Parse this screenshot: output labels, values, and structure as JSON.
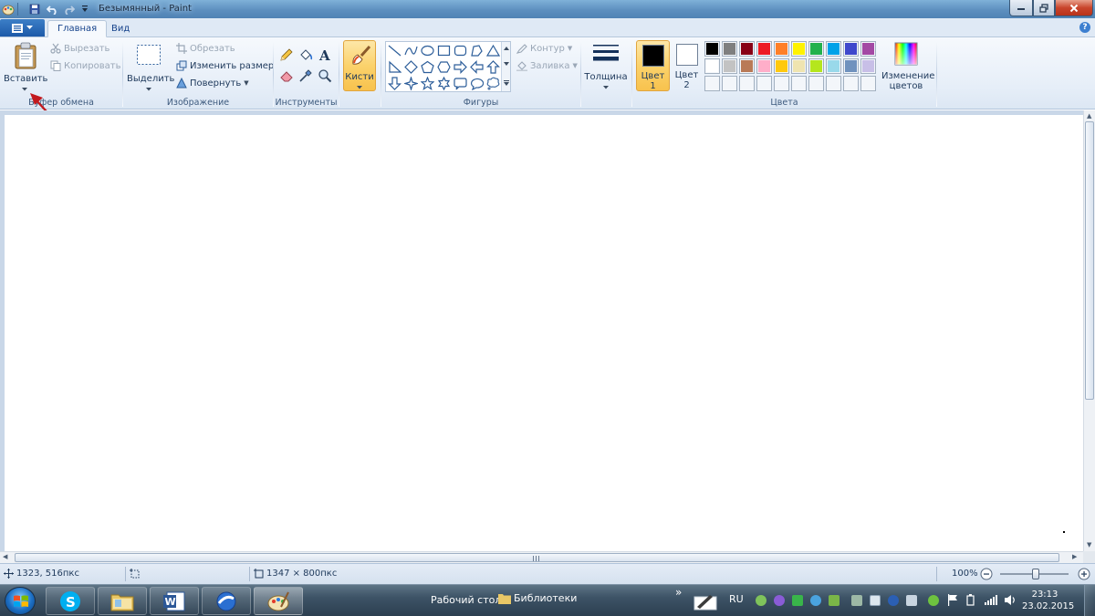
{
  "window": {
    "title": "Безымянный - Paint"
  },
  "tabs": {
    "home": "Главная",
    "view": "Вид"
  },
  "clipboard": {
    "paste_label": "Вставить",
    "cut_label": "Вырезать",
    "copy_label": "Копировать",
    "group_label": "Буфер обмена"
  },
  "image": {
    "select_label": "Выделить",
    "crop_label": "Обрезать",
    "resize_label": "Изменить размер",
    "rotate_label": "Повернуть",
    "group_label": "Изображение"
  },
  "tools": {
    "group_label": "Инструменты",
    "items": [
      "pencil-icon",
      "fill-icon",
      "text-icon",
      "eraser-icon",
      "color-picker-icon",
      "magnifier-icon"
    ]
  },
  "brushes": {
    "label": "Кисти"
  },
  "shapes": {
    "group_label": "Фигуры",
    "outline_label": "Контур",
    "fill_label": "Заливка",
    "items": [
      "line",
      "curve",
      "oval",
      "rectangle",
      "rounded-rectangle",
      "polygon",
      "triangle",
      "right-triangle",
      "diamond",
      "pentagon",
      "hexagon",
      "right-arrow",
      "left-arrow",
      "up-arrow",
      "down-arrow",
      "four-point-star",
      "five-point-star",
      "six-point-star",
      "rounded-callout",
      "oval-callout",
      "cloud-callout"
    ]
  },
  "thickness": {
    "label": "Толщина"
  },
  "colors": {
    "group_label": "Цвета",
    "color1_label": "Цвет",
    "color1_num": "1",
    "color2_label": "Цвет",
    "color2_num": "2",
    "color1_value": "#000000",
    "color2_value": "#ffffff",
    "edit_label_1": "Изменение",
    "edit_label_2": "цветов",
    "palette_row1": [
      "#000000",
      "#7f7f7f",
      "#880015",
      "#ed1c24",
      "#ff7f27",
      "#fff200",
      "#22b14c",
      "#00a2e8",
      "#3f48cc",
      "#a349a4"
    ],
    "palette_row2": [
      "#ffffff",
      "#c3c3c3",
      "#b97a57",
      "#ffaec9",
      "#ffc90e",
      "#efe4b0",
      "#b5e61d",
      "#99d9ea",
      "#7092be",
      "#c8bfe7"
    ]
  },
  "status": {
    "cursor_pos": "1323, 516пкс",
    "canvas_size": "1347 × 800пкс",
    "zoom": "100%"
  },
  "taskbar": {
    "desktop_label": "Рабочий стол",
    "libraries_label": "Библиотеки",
    "language": "RU",
    "time": "23:13",
    "date": "23.02.2015"
  }
}
